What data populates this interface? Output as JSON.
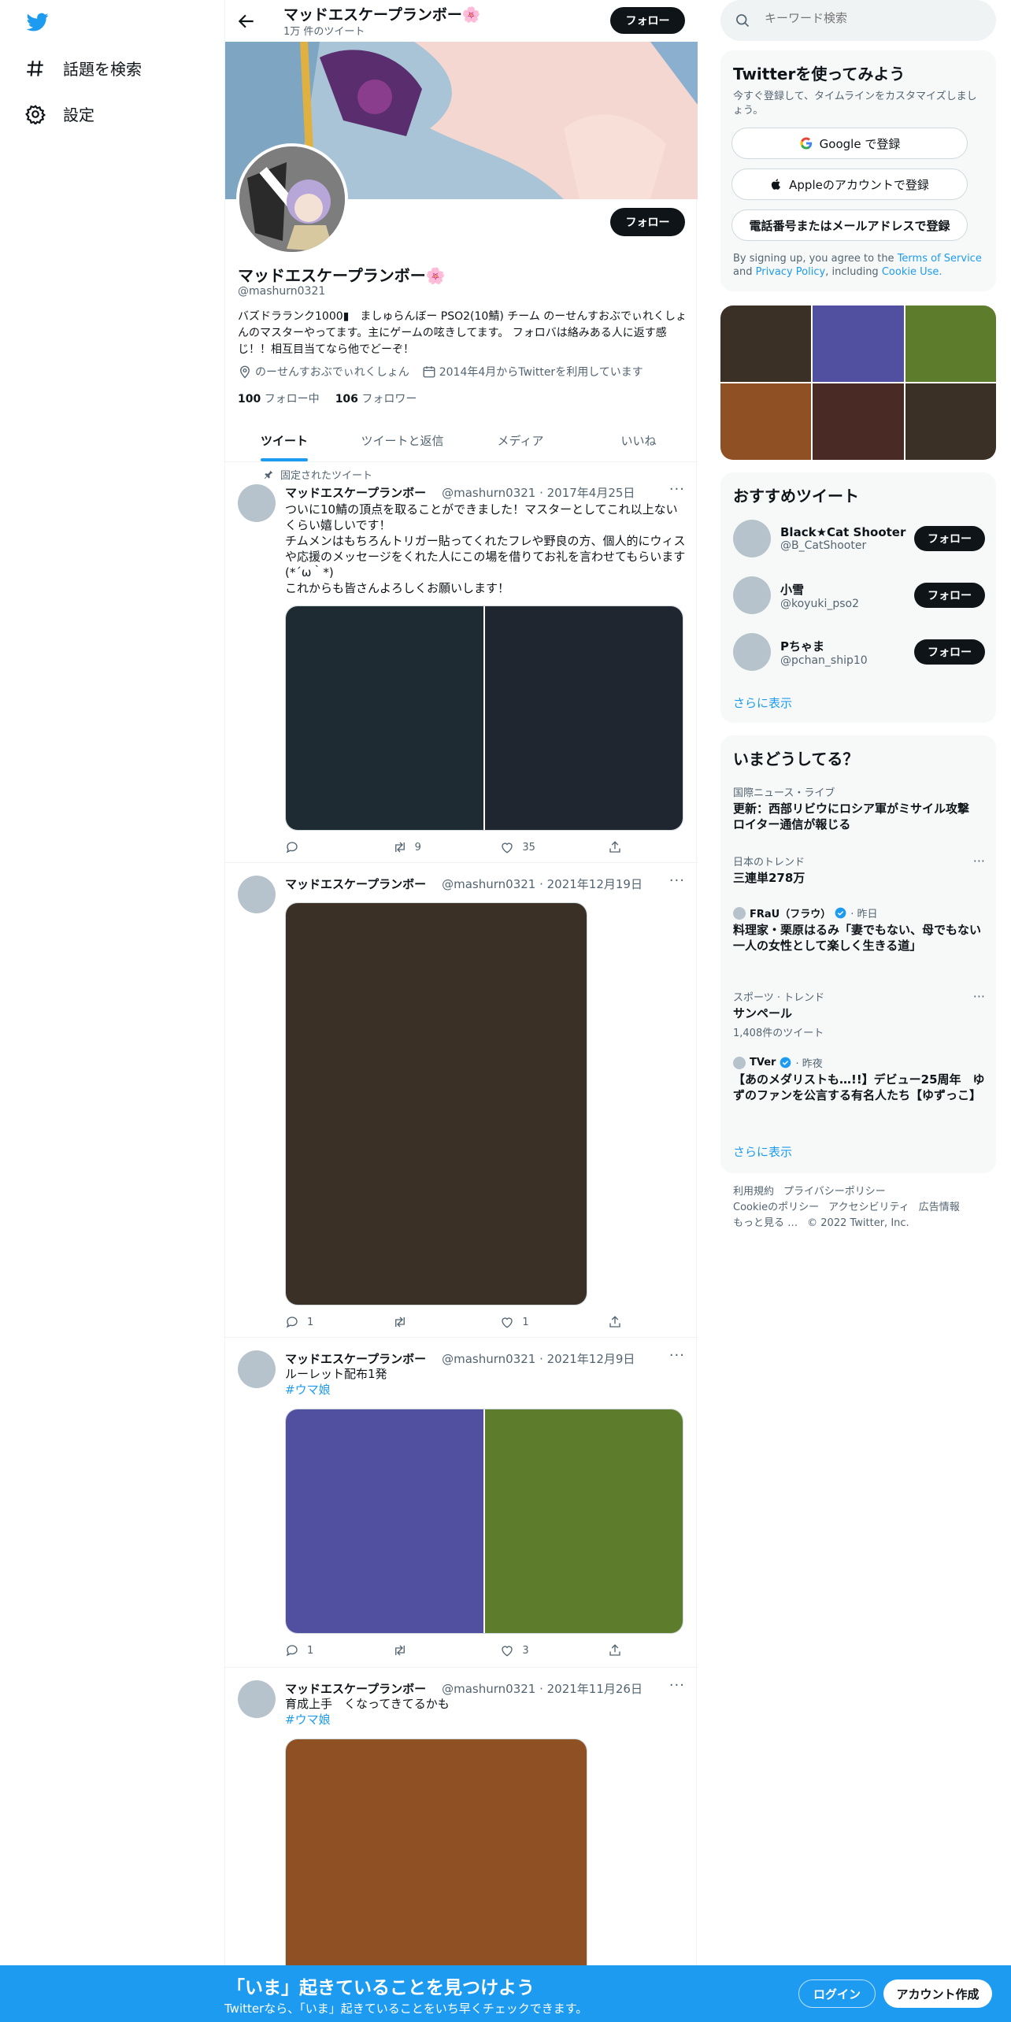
{
  "nav": {
    "items": [
      {
        "label": "話題を検索",
        "icon": "hashtag-icon"
      },
      {
        "label": "設定",
        "icon": "gear-icon"
      }
    ]
  },
  "header": {
    "title": "マッドエスケープランボー🌸",
    "tweet_count": "1万 件のツイート",
    "follow_label": "フォロー"
  },
  "profile": {
    "name": "マッドエスケープランボー🌸",
    "handle": "@mashurn0321",
    "bio": "バズドララ​ンク1000▮　ましゅらんぼー PSO2(10鯖) チーム のーせんすおぶでぃれくしょんのマスターやってます。主にゲームの呟きしてます。 フォロバは絡みある人に返す感じ！！相互目当てなら他でどーぞ！",
    "location": "のーせんすおぶでぃれくしょん",
    "joined": "2014年4月からTwitterを利用しています",
    "following_count": "100",
    "following_label": "フォロー中",
    "followers_count": "106",
    "followers_label": "フォロワー",
    "follow_label": "フォロー"
  },
  "tabs": [
    "ツイート",
    "ツイートと返信",
    "メディア",
    "いいね"
  ],
  "tweets": [
    {
      "pinned_label": "固定されたツイート",
      "name": "マッドエスケープランボー",
      "meta": "@mashurn0321 · 2017年4月25日",
      "text": "ついに10鯖の頂点を取ることができました！マスターとしてこれ以上ないくらい嬉しいです！\nチムメンはもちろんトリガー貼ってくれたフレや野良の方、個人的にウィスや応援のメッセージをくれた人にこの場を借りてお礼を言わせてもらいます(*´ω｀*)\nこれからも皆さんよろしくお願いします！",
      "replies": "",
      "retweets": "9",
      "likes": "35"
    },
    {
      "name": "マッドエスケープランボー",
      "meta": "@mashurn0321 · 2021年12月19日",
      "replies": "1",
      "retweets": "",
      "likes": "1"
    },
    {
      "name": "マッドエスケープランボー",
      "meta": "@mashurn0321 · 2021年12月9日",
      "text": "ルーレット配布1発",
      "hashtag": "#ウマ娘",
      "replies": "1",
      "retweets": "",
      "likes": "3"
    },
    {
      "name": "マッドエスケープランボー",
      "meta": "@mashurn0321 · 2021年11月26日",
      "text": "育成上手　くなってきてるかも",
      "hashtag": "#ウマ娘"
    }
  ],
  "search": {
    "placeholder": "キーワード検索"
  },
  "signup": {
    "title": "Twitterを使ってみよう",
    "desc": "今すぐ登録して、タイムラインをカスタマイズしましょう。",
    "google": "Google で登録",
    "apple": "Appleのアカウントで登録",
    "phone": "電話番号またはメールアドレスで登録",
    "terms_prefix": "By signing up, you agree to the",
    "terms_link": "Terms of Service",
    "terms_and": "and",
    "privacy_link": "Privacy Policy",
    "terms_including": ", including",
    "cookie_link": "Cookie Use."
  },
  "media_colors": [
    "#3a3026",
    "#5150a0",
    "#5e7d2c",
    "#8f5024",
    "#4a2a24",
    "#3a3026"
  ],
  "suggested": {
    "title": "おすすめツイート",
    "users": [
      {
        "name": "Black★Cat Shooter",
        "handle": "@B_CatShooter"
      },
      {
        "name": "小雪",
        "handle": "@koyuki_pso2"
      },
      {
        "name": "Pちゃま",
        "handle": "@pchan_ship10"
      }
    ],
    "follow_label": "フォロー",
    "show_more": "さらに表示"
  },
  "trends": {
    "title": "いまどうしてる？",
    "items": [
      {
        "category": "国際ニュース・ライブ",
        "title": "更新：西部リビウにロシア軍がミサイル攻撃 ロイター通信が報じる"
      },
      {
        "category": "日本のトレンド",
        "title": "三連単278万"
      },
      {
        "source": "FRaU（フラウ）",
        "time": "· 昨日",
        "title": "料理家・栗原はるみ「妻でもない、母でもない一人の女性として楽しく生きる道」"
      },
      {
        "category": "スポーツ · トレンド",
        "title": "サンペール",
        "sub": "1,408件のツイート"
      },
      {
        "source": "TVer",
        "time": "· 昨夜",
        "title": "【あのメダリストも…!!】デビュー25周年　ゆずのファンを公言する有名人たち【ゆずっこ】"
      }
    ],
    "show_more": "さらに表示"
  },
  "footer": {
    "links": [
      "利用規約",
      "プライバシーポリシー",
      "Cookieのポリシー",
      "アクセシビリティ",
      "広告情報",
      "もっと見る …"
    ],
    "copyright": "© 2022 Twitter, Inc."
  },
  "bottom_bar": {
    "title": "「いま」起きていることを見つけよう",
    "sub": "Twitterなら、「いま」起きていることをいち早くチェックできます。",
    "login": "ログイン",
    "signup": "アカウント作成"
  },
  "colors": {
    "accent": "#1d9bf0",
    "text": "#0f1419",
    "muted": "#536471"
  }
}
